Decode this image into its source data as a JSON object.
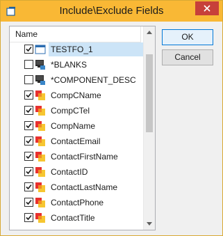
{
  "window": {
    "title": "Include\\Exclude Fields",
    "accent": "#f9b835",
    "close_color": "#c7403a"
  },
  "list": {
    "column_header": "Name",
    "selection_color": "#cce4f7",
    "items": [
      {
        "label": "TESTFO_1",
        "checked": true,
        "icon": "table-icon",
        "selected": true
      },
      {
        "label": "*BLANKS",
        "checked": false,
        "icon": "component-icon",
        "selected": false
      },
      {
        "label": "*COMPONENT_DESC",
        "checked": false,
        "icon": "component-icon",
        "selected": false
      },
      {
        "label": "CompCName",
        "checked": true,
        "icon": "field-icon",
        "selected": false
      },
      {
        "label": "CompCTel",
        "checked": true,
        "icon": "field-icon",
        "selected": false
      },
      {
        "label": "CompName",
        "checked": true,
        "icon": "field-icon",
        "selected": false
      },
      {
        "label": "ContactEmail",
        "checked": true,
        "icon": "field-icon",
        "selected": false
      },
      {
        "label": "ContactFirstName",
        "checked": true,
        "icon": "field-icon",
        "selected": false
      },
      {
        "label": "ContactID",
        "checked": true,
        "icon": "field-icon",
        "selected": false
      },
      {
        "label": "ContactLastName",
        "checked": true,
        "icon": "field-icon",
        "selected": false
      },
      {
        "label": "ContactPhone",
        "checked": true,
        "icon": "field-icon",
        "selected": false
      },
      {
        "label": "ContactTitle",
        "checked": true,
        "icon": "field-icon",
        "selected": false
      }
    ]
  },
  "buttons": {
    "ok_label": "OK",
    "cancel_label": "Cancel"
  }
}
